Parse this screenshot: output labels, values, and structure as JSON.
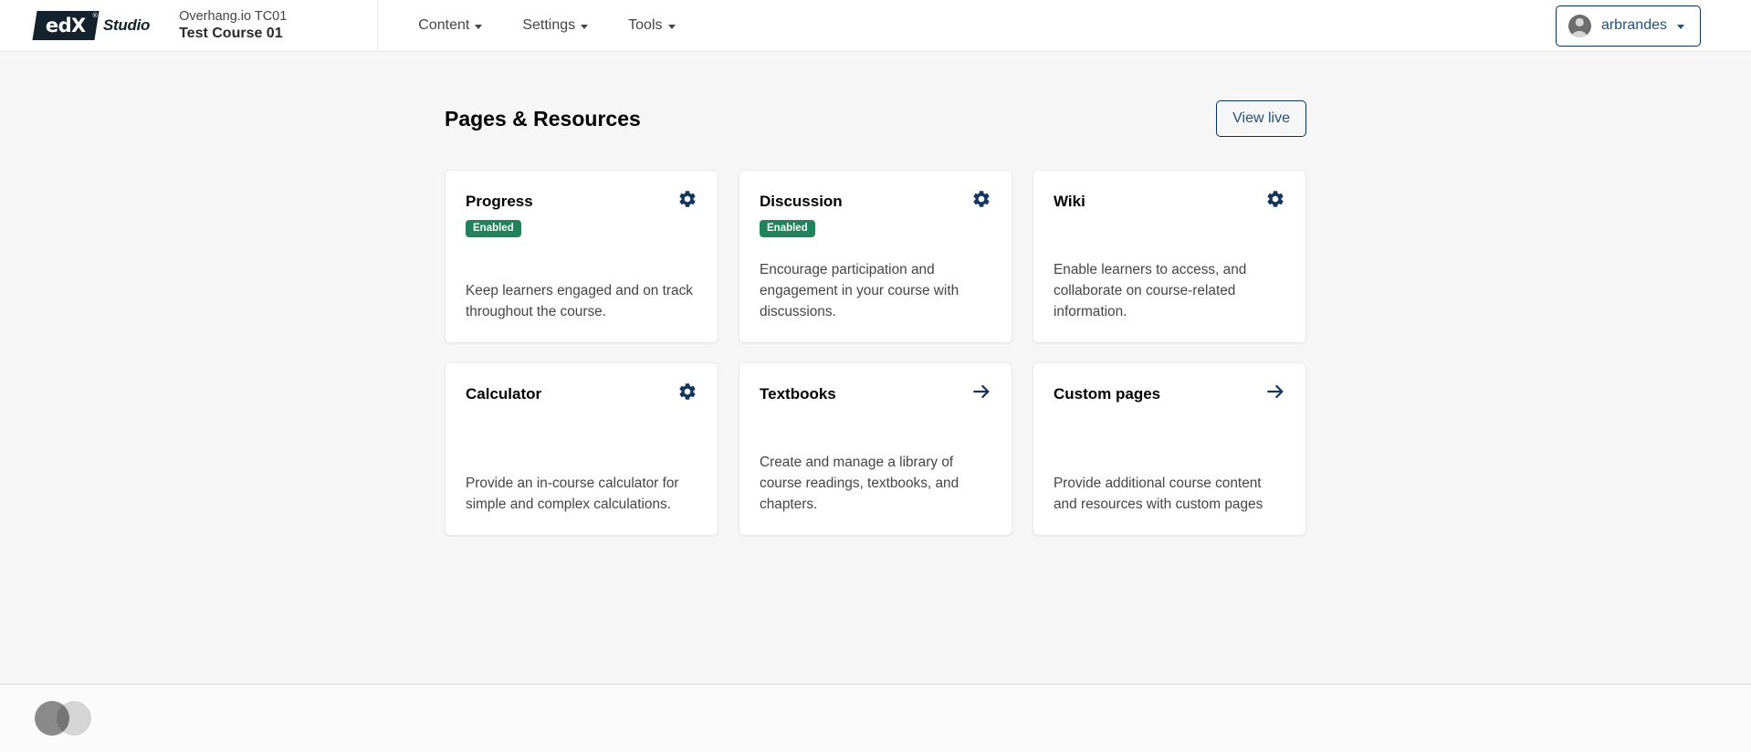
{
  "header": {
    "logo_text": "edX",
    "logo_registered": "®",
    "studio_text": "Studio",
    "course_org": "Overhang.io TC01",
    "course_name": "Test Course 01",
    "nav_items": [
      {
        "label": "Content",
        "icon": "chevron-down-icon"
      },
      {
        "label": "Settings",
        "icon": "chevron-down-icon"
      },
      {
        "label": "Tools",
        "icon": "chevron-down-icon"
      }
    ],
    "user": {
      "name": "arbrandes",
      "avatar_icon": "user-avatar-icon",
      "caret_icon": "chevron-down-icon"
    }
  },
  "main": {
    "page_title": "Pages & Resources",
    "view_live_label": "View live",
    "cards": [
      {
        "title": "Progress",
        "badge": "Enabled",
        "description": "Keep learners engaged and on track throughout the course.",
        "icon": "gear-icon"
      },
      {
        "title": "Discussion",
        "badge": "Enabled",
        "description": "Encourage participation and engagement in your course with discussions.",
        "icon": "gear-icon"
      },
      {
        "title": "Wiki",
        "badge": "",
        "description": "Enable learners to access, and collaborate on course-related information.",
        "icon": "gear-icon"
      },
      {
        "title": "Calculator",
        "badge": "",
        "description": "Provide an in-course calculator for simple and complex calculations.",
        "icon": "gear-icon"
      },
      {
        "title": "Textbooks",
        "badge": "",
        "description": "Create and manage a library of course readings, textbooks, and chapters.",
        "icon": "arrow-right-icon"
      },
      {
        "title": "Custom pages",
        "badge": "",
        "description": "Provide additional course content and resources with custom pages",
        "icon": "arrow-right-icon"
      }
    ]
  },
  "footer": {
    "widget_icon": "overlapping-circles-icon"
  },
  "colors": {
    "accent_navy": "#0a3055",
    "link_blue": "#23527c",
    "badge_green": "#21825c",
    "page_bg": "#f7f6f6",
    "icon_navy": "#15365c"
  }
}
